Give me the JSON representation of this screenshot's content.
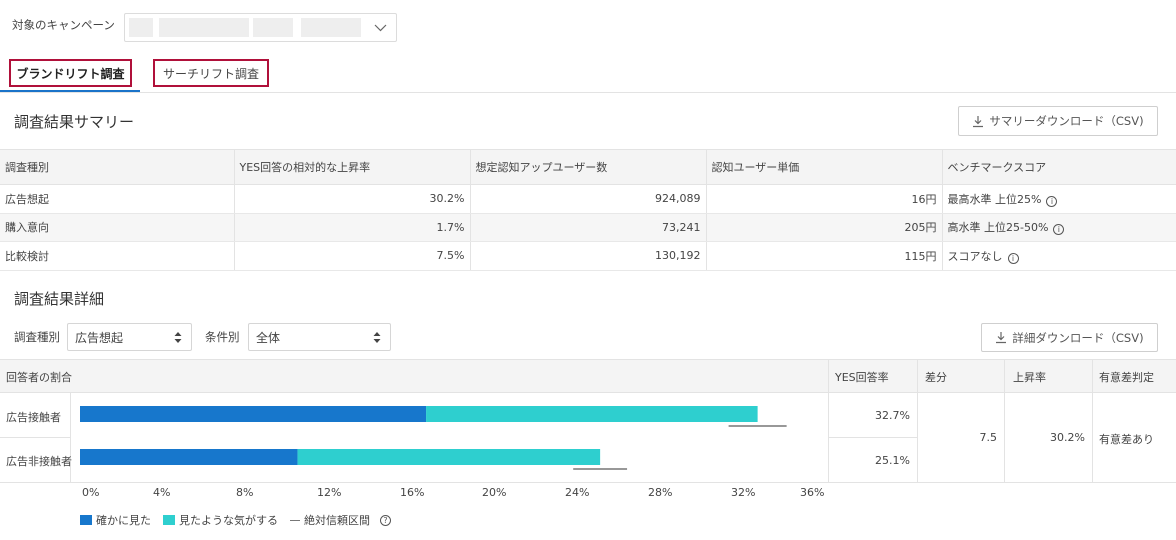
{
  "campaign": {
    "label": "対象のキャンペーン",
    "value": ""
  },
  "tabs": [
    {
      "label": "ブランドリフト調査",
      "active": true
    },
    {
      "label": "サーチリフト調査",
      "active": false
    }
  ],
  "summary": {
    "title": "調査結果サマリー",
    "download_label": "サマリーダウンロード（CSV)",
    "columns": [
      "調査種別",
      "YES回答の相対的な上昇率",
      "想定認知アップユーザー数",
      "認知ユーザー単価",
      "ベンチマークスコア"
    ],
    "rows": [
      {
        "type": "広告想起",
        "lift": "30.2%",
        "users": "924,089",
        "unit_cost": "16円",
        "benchmark": "最高水準 上位25%"
      },
      {
        "type": "購入意向",
        "lift": "1.7%",
        "users": "73,241",
        "unit_cost": "205円",
        "benchmark": "高水準 上位25-50%"
      },
      {
        "type": "比較検討",
        "lift": "7.5%",
        "users": "130,192",
        "unit_cost": "115円",
        "benchmark": "スコアなし"
      }
    ]
  },
  "detail": {
    "title": "調査結果詳細",
    "download_label": "詳細ダウンロード（CSV)",
    "filter_type_label": "調査種別",
    "filter_type_value": "広告想起",
    "filter_cond_label": "条件別",
    "filter_cond_value": "全体",
    "columns": {
      "ratio": "回答者の割合",
      "yes_rate": "YES回答率",
      "diff": "差分",
      "lift": "上昇率",
      "significance": "有意差判定"
    },
    "rows": [
      {
        "label": "広告接触者",
        "yes_rate": "32.7%"
      },
      {
        "label": "広告非接触者",
        "yes_rate": "25.1%"
      }
    ],
    "diff_value": "7.5",
    "lift_value": "30.2%",
    "significance_value": "有意差あり"
  },
  "chart_data": {
    "type": "bar",
    "orientation": "horizontal",
    "stacked": true,
    "categories": [
      "広告接触者",
      "広告非接触者"
    ],
    "series": [
      {
        "name": "確かに見た",
        "values": [
          16.7,
          10.5
        ],
        "color": "#1777cc"
      },
      {
        "name": "見たような気がする",
        "values": [
          16.0,
          14.6
        ],
        "color": "#2ecfcf"
      }
    ],
    "confidence_interval": {
      "name": "絶対信頼区間",
      "ranges": [
        [
          31.3,
          34.1
        ],
        [
          23.8,
          26.4
        ]
      ],
      "color": "#777777"
    },
    "x_ticks": [
      "0%",
      "4%",
      "8%",
      "12%",
      "16%",
      "20%",
      "24%",
      "28%",
      "32%",
      "36%"
    ],
    "xlim": [
      0,
      36
    ],
    "legend_position": "bottom-left"
  },
  "colors": {
    "accent": "#1a73c9",
    "tab_border": "#b0103a",
    "dark_bar": "#1777cc",
    "light_bar": "#2ecfcf"
  }
}
